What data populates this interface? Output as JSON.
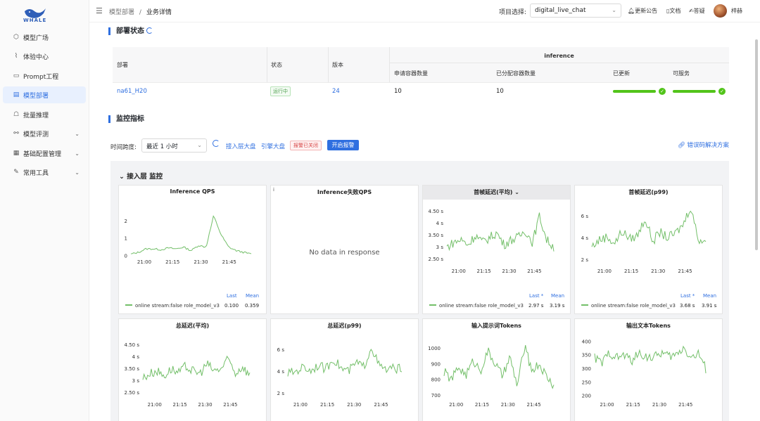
{
  "app": {
    "logo_text": "WHALE"
  },
  "sidebar": {
    "items": [
      {
        "label": "模型广场",
        "icon": "cube-icon"
      },
      {
        "label": "体验中心",
        "icon": "chart-icon"
      },
      {
        "label": "Prompt工程",
        "icon": "chat-icon"
      },
      {
        "label": "模型部署",
        "icon": "deploy-icon",
        "active": true
      },
      {
        "label": "批量推理",
        "icon": "robot-icon"
      },
      {
        "label": "模型评测",
        "icon": "eval-icon",
        "expandable": true
      },
      {
        "label": "基础配置管理",
        "icon": "grid-icon",
        "expandable": true
      },
      {
        "label": "常用工具",
        "icon": "wrench-icon",
        "expandable": true
      }
    ]
  },
  "header": {
    "breadcrumb": [
      "模型部署",
      "/",
      "业务详情"
    ],
    "project_label": "项目选择:",
    "project_value": "digital_live_chat",
    "links": [
      "更新公告",
      "文档",
      "答疑"
    ],
    "username": "梓赫"
  },
  "deploy_status": {
    "title": "部署状态",
    "columns": {
      "deploy": "部署",
      "status": "状态",
      "version": "版本",
      "group": "inference",
      "requested": "申请容器数量",
      "allocated": "已分配容器数量",
      "updated": "已更新",
      "serving": "可服务"
    },
    "row": {
      "deploy": "na61_H20",
      "status": "运行中",
      "version": "24",
      "requested": "10",
      "allocated": "10",
      "updated_progress": 1.0,
      "serving_progress": 1.0
    }
  },
  "monitor": {
    "title": "监控指标",
    "time_label": "时间跨度:",
    "time_value": "最近 1 小时",
    "links": [
      "接入层大盘",
      "引擎大盘"
    ],
    "alarm_tag": "报警已关闭",
    "alarm_button": "开启报警",
    "error_link": "错误码解决方案",
    "dashboard_title": "接入层 监控"
  },
  "panels": [
    {
      "title": "Inference QPS",
      "yticks": [
        "2",
        "1",
        "0"
      ],
      "xticks": [
        "21:00",
        "21:15",
        "21:30",
        "21:45"
      ],
      "legend": "online stream:false role_model_v3",
      "last_label": "Last",
      "mean_label": "Mean",
      "last": "0.100",
      "mean": "0.359"
    },
    {
      "title": "Inference失败QPS",
      "no_data": "No data in response",
      "info": "i"
    },
    {
      "title": "首帧延迟(平均)",
      "title_suffix": "⌄",
      "yticks": [
        "4.50 s",
        "4 s",
        "3.50 s",
        "3 s",
        "2.50 s"
      ],
      "xticks": [
        "21:00",
        "21:15",
        "21:30",
        "21:45"
      ],
      "legend": "online stream:false role_model_v3",
      "last_label": "Last *",
      "mean_label": "Mean",
      "last": "2.97 s",
      "mean": "3.19 s"
    },
    {
      "title": "首帧延迟(p99)",
      "yticks": [
        "6 s",
        "4 s",
        "2 s"
      ],
      "xticks": [
        "21:00",
        "21:15",
        "21:30",
        "21:45"
      ],
      "legend": "online stream:false role_model_v3",
      "last_label": "Last *",
      "mean_label": "Mean",
      "last": "3.68 s",
      "mean": "3.91 s"
    },
    {
      "title": "总延迟(平均)",
      "yticks": [
        "4.50 s",
        "4 s",
        "3.50 s",
        "3 s",
        "2.50 s"
      ],
      "xticks": [
        "21:00",
        "21:15",
        "21:30",
        "21:45"
      ]
    },
    {
      "title": "总延迟(p99)",
      "yticks": [
        "6 s",
        "4 s",
        "2 s"
      ],
      "xticks": [
        "21:00",
        "21:15",
        "21:30",
        "21:45"
      ]
    },
    {
      "title": "输入提示词Tokens",
      "yticks": [
        "1000",
        "900",
        "800",
        "700"
      ],
      "xticks": [
        "21:00",
        "21:15",
        "21:30",
        "21:45"
      ]
    },
    {
      "title": "输出文本Tokens",
      "yticks": [
        "400",
        "350",
        "300",
        "250",
        "200"
      ],
      "xticks": [
        "21:00",
        "21:15",
        "21:30",
        "21:45"
      ]
    }
  ],
  "chart_data": [
    {
      "type": "line",
      "title": "Inference QPS",
      "x": [
        "21:00",
        "21:15",
        "21:30",
        "21:45"
      ],
      "ylim": [
        0,
        2.5
      ],
      "series": [
        {
          "name": "online stream:false role_model_v3",
          "values": [
            0.1,
            0.2,
            0.4,
            0.4,
            0.35,
            0.45,
            0.4,
            0.5,
            0.3,
            0.6,
            0.5,
            2.3,
            1.2,
            0.5,
            0.3,
            0.2,
            0.1
          ]
        }
      ]
    },
    {
      "type": "line",
      "title": "首帧延迟(平均)",
      "x": [
        "21:00",
        "21:15",
        "21:30",
        "21:45"
      ],
      "ylim": [
        2.25,
        4.75
      ],
      "series": [
        {
          "name": "online stream:false role_model_v3",
          "values": [
            3.0,
            3.2,
            3.3,
            3.1,
            3.5,
            3.2,
            3.4,
            3.6,
            3.1,
            3.3,
            3.4,
            3.7,
            3.2,
            4.3,
            3.3,
            3.0
          ]
        }
      ]
    },
    {
      "type": "line",
      "title": "首帧延迟(p99)",
      "x": [
        "21:00",
        "21:15",
        "21:30",
        "21:45"
      ],
      "ylim": [
        1.5,
        7
      ],
      "series": [
        {
          "name": "online stream:false role_model_v3",
          "values": [
            3.2,
            3.8,
            4.1,
            3.5,
            4.6,
            3.9,
            4.2,
            5.8,
            3.7,
            4.5,
            4.0,
            4.4,
            5.2,
            6.9,
            3.9,
            3.7
          ]
        }
      ]
    },
    {
      "type": "line",
      "title": "总延迟(平均)",
      "x": [
        "21:00",
        "21:15",
        "21:30",
        "21:45"
      ],
      "ylim": [
        2.25,
        4.75
      ],
      "series": [
        {
          "values": [
            3.1,
            3.3,
            3.4,
            3.2,
            3.5,
            3.3,
            3.6,
            3.4,
            3.3,
            3.7,
            3.4,
            3.5,
            3.9,
            3.3,
            3.6,
            3.2
          ]
        }
      ]
    },
    {
      "type": "line",
      "title": "总延迟(p99)",
      "x": [
        "21:00",
        "21:15",
        "21:30",
        "21:45"
      ],
      "ylim": [
        1.5,
        7
      ],
      "series": [
        {
          "values": [
            3.8,
            4.0,
            4.4,
            4.1,
            4.6,
            4.2,
            5.2,
            4.3,
            4.0,
            4.8,
            4.4,
            6.3,
            4.5,
            4.1,
            4.3,
            4.2
          ]
        }
      ]
    },
    {
      "type": "line",
      "title": "输入提示词Tokens",
      "x": [
        "21:00",
        "21:15",
        "21:30",
        "21:45"
      ],
      "ylim": [
        680,
        1060
      ],
      "series": [
        {
          "values": [
            850,
            800,
            880,
            830,
            920,
            860,
            980,
            900,
            820,
            940,
            760,
            1010,
            860,
            900,
            820,
            760
          ]
        }
      ]
    },
    {
      "type": "line",
      "title": "输出文本Tokens",
      "x": [
        "21:00",
        "21:15",
        "21:30",
        "21:45"
      ],
      "ylim": [
        190,
        410
      ],
      "series": [
        {
          "values": [
            340,
            320,
            360,
            340,
            350,
            330,
            355,
            345,
            340,
            360,
            345,
            350,
            380,
            340,
            355,
            300
          ]
        }
      ]
    }
  ]
}
